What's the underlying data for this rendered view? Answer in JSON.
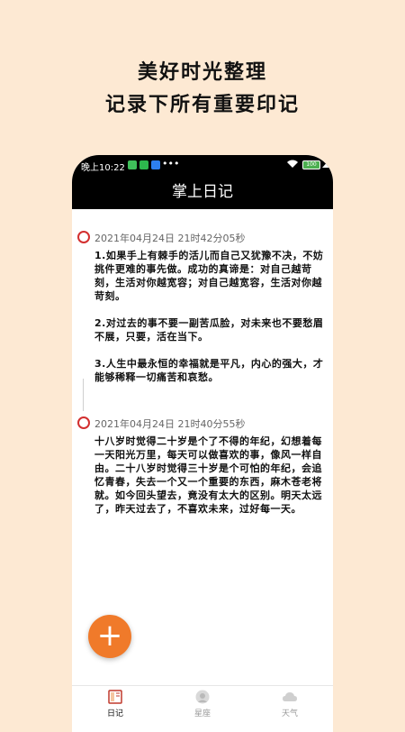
{
  "promo": {
    "line1": "美好时光整理",
    "line2": "记录下所有重要印记"
  },
  "statusbar": {
    "time": "晚上10:22",
    "more": "•••",
    "battery": "100"
  },
  "appbar": {
    "title": "掌上日记"
  },
  "entries": [
    {
      "date": "2021年04月24日 21时42分05秒",
      "paragraphs": [
        "1.如果手上有棘手的活儿而自己又犹豫不决，不妨挑件更难的事先做。成功的真谛是：对自己越苛刻，生活对你越宽容；对自己越宽容，生活对你越苛刻。",
        "2.对过去的事不要一副苦瓜脸，对未来也不要愁眉不展，只要，活在当下。",
        "3.人生中最永恒的幸福就是平凡，内心的强大，才能够稀释一切痛苦和哀愁。"
      ]
    },
    {
      "date": "2021年04月24日 21时40分55秒",
      "paragraphs": [
        "十八岁时觉得二十岁是个了不得的年纪，幻想着每一天阳光万里，每天可以做喜欢的事，像风一样自由。二十八岁时觉得三十岁是个可怕的年纪，会追忆青春，失去一个又一个重要的东西，麻木苍老将就。如今回头望去，竟没有太大的区别。明天太远了，昨天过去了，不喜欢未来，过好每一天。"
      ]
    }
  ],
  "fab": {
    "label": "+"
  },
  "nav": {
    "diary": "日记",
    "star": "星座",
    "weather": "天气"
  },
  "colors": {
    "background": "#fde9d3",
    "accent": "#f07a2a",
    "timeline_dot": "#d32f2f",
    "appbar": "#000000"
  }
}
